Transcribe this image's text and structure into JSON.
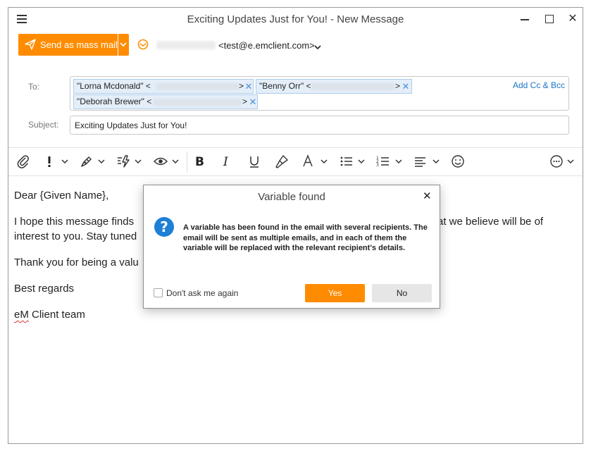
{
  "window": {
    "title": "Exciting Updates Just for You! - New Message"
  },
  "send": {
    "label": "Send as mass mail"
  },
  "from": {
    "address": "<test@e.emclient.com>"
  },
  "header": {
    "to_label": "To:",
    "subject_label": "Subject:",
    "add_cc_bcc": "Add Cc & Bcc",
    "recipients": [
      {
        "name": "\"Lorna Mcdonald\" <"
      },
      {
        "name": "\"Benny Orr\" <"
      },
      {
        "name": "\"Deborah Brewer\" <"
      }
    ],
    "subject_value": "Exciting Updates Just for You!"
  },
  "body": {
    "greeting": "Dear {Given Name},",
    "line1_start": "I hope this message finds",
    "line1_end": "at we believe will be of",
    "line2_start": "interest to you. Stay tuned",
    "line3_start": "Thank you for being a valu",
    "closing": "Best regards",
    "sig_em": "eM",
    "sig_rest": " Client team"
  },
  "dialog": {
    "title": "Variable found",
    "message": "A variable has been found in the email with several recipients. The email will be sent as multiple emails, and in each of them the variable will be replaced with the relevant recipient's details.",
    "checkbox_label": "Don't ask me again",
    "yes_label": "Yes",
    "no_label": "No"
  },
  "colors": {
    "accent": "#ff8c00",
    "link": "#1a73c8",
    "chip_bg": "#e4eef9",
    "info_icon": "#1e7fd6"
  }
}
